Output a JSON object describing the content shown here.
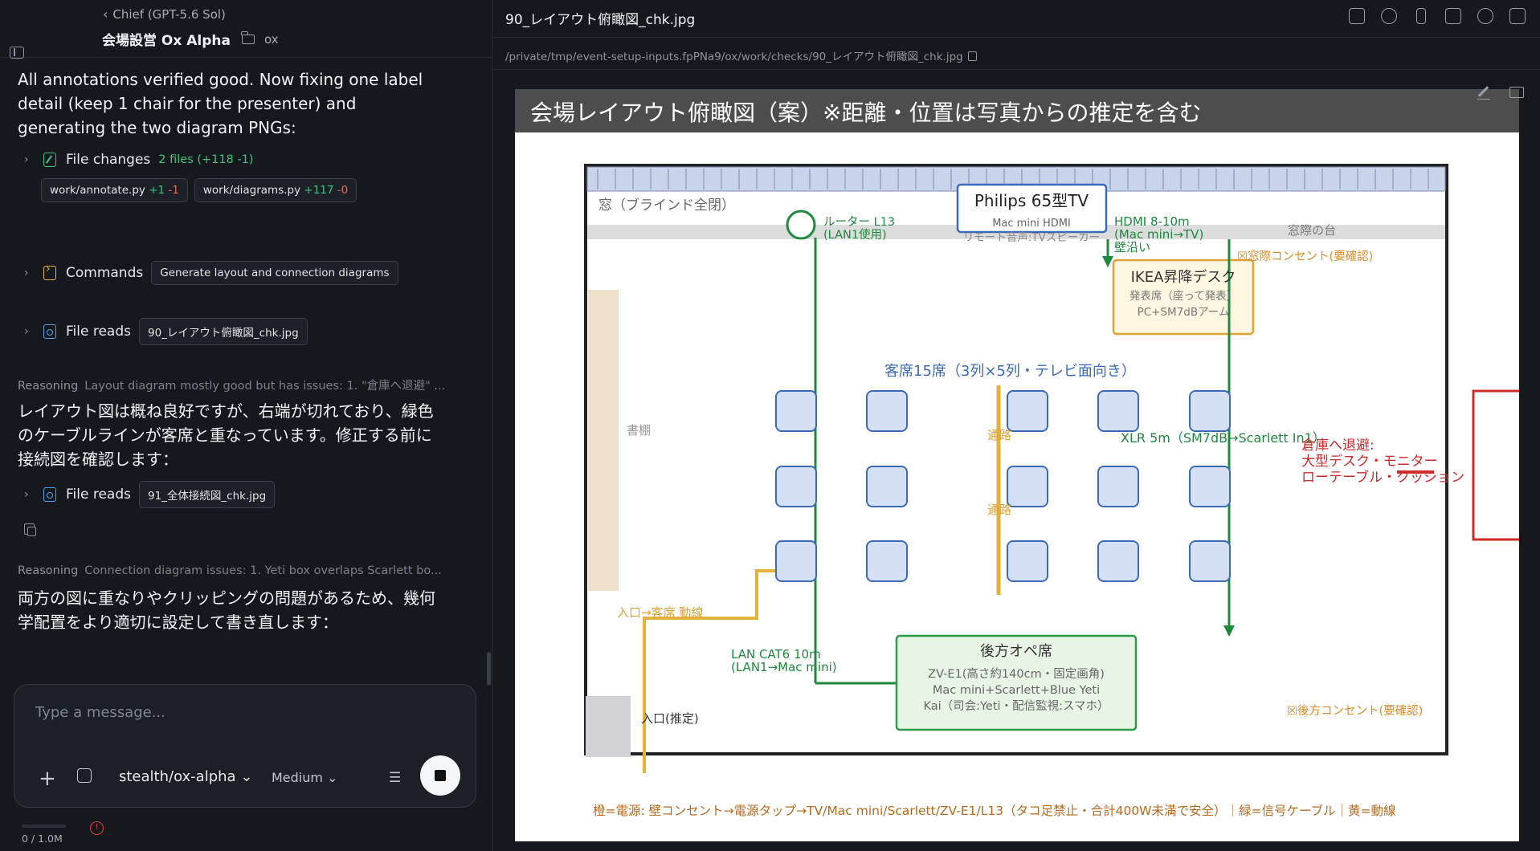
{
  "header": {
    "back_label": "Chief (GPT-5.6 Sol)",
    "project": "会場設営 Ox Alpha",
    "directory": "ox"
  },
  "chat": {
    "message_1": "All annotations verified good. Now fixing one label detail (keep 1 chair for the presenter) and generating the two diagram PNGs:",
    "file_changes": {
      "label": "File changes",
      "summary": "2 files (+118 -1)",
      "files": [
        {
          "name": "work/annotate.py",
          "plus": "+1",
          "minus": "-1"
        },
        {
          "name": "work/diagrams.py",
          "plus": "+117",
          "minus": "-0"
        }
      ]
    },
    "commands": {
      "label": "Commands",
      "chip": "Generate layout and connection diagrams"
    },
    "file_reads_1": {
      "label": "File reads",
      "chip": "90_レイアウト俯瞰図_chk.jpg"
    },
    "reasoning_1": {
      "label": "Reasoning",
      "text": "Layout diagram mostly good but has issues: 1. \"倉庫へ退避\" ..."
    },
    "message_2": "レイアウト図は概ね良好ですが、右端が切れており、緑色のケーブルラインが客席と重なっています。修正する前に接続図を確認します：",
    "file_reads_2": {
      "label": "File reads",
      "chip": "91_全体接続図_chk.jpg"
    },
    "reasoning_2": {
      "label": "Reasoning",
      "text": "Connection diagram issues: 1. Yeti box overlaps Scarlett bo..."
    },
    "message_3": "両方の図に重なりやクリッピングの問題があるため、幾何学配置をより適切に設定して書き直します："
  },
  "composer": {
    "placeholder": "Type a message...",
    "model": "stealth/ox-alpha",
    "effort": "Medium",
    "usage": "0 / 1.0M"
  },
  "viewer": {
    "filename": "90_レイアウト俯瞰図_chk.jpg",
    "path": "/private/tmp/event-setup-inputs.fpPNa9/ox/work/checks/90_レイアウト俯瞰図_chk.jpg"
  },
  "diagram": {
    "title": "会場レイアウト俯瞰図（案）※距離・位置は写真からの推定を含む",
    "window_label": "窓（ブラインド全閉）",
    "tv_title": "Philips 65型TV",
    "tv_sub": "Mac mini HDMI",
    "tv_sub2": "リモート音声:TVスピーカー",
    "router": "ルーター L13",
    "router_sub": "(LAN1使用)",
    "hdmi": "HDMI 8-10m",
    "hdmi_sub": "(Mac mini→TV)",
    "hdmi_sub2": "壁沿い",
    "window_stand": "窓際の台",
    "outlet_window": "☒窓際コンセント(要確認)",
    "desk_title": "IKEA昇降デスク",
    "desk_sub1": "発表席（座って発表）",
    "desk_sub2": "PC+SM7dBアーム",
    "seats_label": "客席15席（3列×5列・テレビ面向き）",
    "bookshelf": "書棚",
    "aisle1": "通路",
    "aisle2": "通路",
    "xlr": "XLR 5m（SM7dB→Scarlett In1）",
    "storage1": "倉庫へ退避:",
    "storage2": "大型デスク・モニター",
    "storage3": "ローテーブル・クッション",
    "entry_flow": "入口→客席 動線",
    "lan": "LAN CAT6 10m",
    "lan_sub": "(LAN1→Mac mini)",
    "entrance": "入口(推定)",
    "ops_title": "後方オペ席",
    "ops_1": "ZV-E1(高さ約140cm・固定画角)",
    "ops_2": "Mac mini+Scarlett+Blue Yeti",
    "ops_3": "Kai（司会:Yeti・配信監視:スマホ）",
    "outlet_back": "☒後方コンセント(要確認)",
    "legend": "橙=電源: 壁コンセント→電源タップ→TV/Mac mini/Scarlett/ZV-E1/L13（タコ足禁止・合計400W未満で安全）｜緑=信号ケーブル｜黄=動線"
  }
}
